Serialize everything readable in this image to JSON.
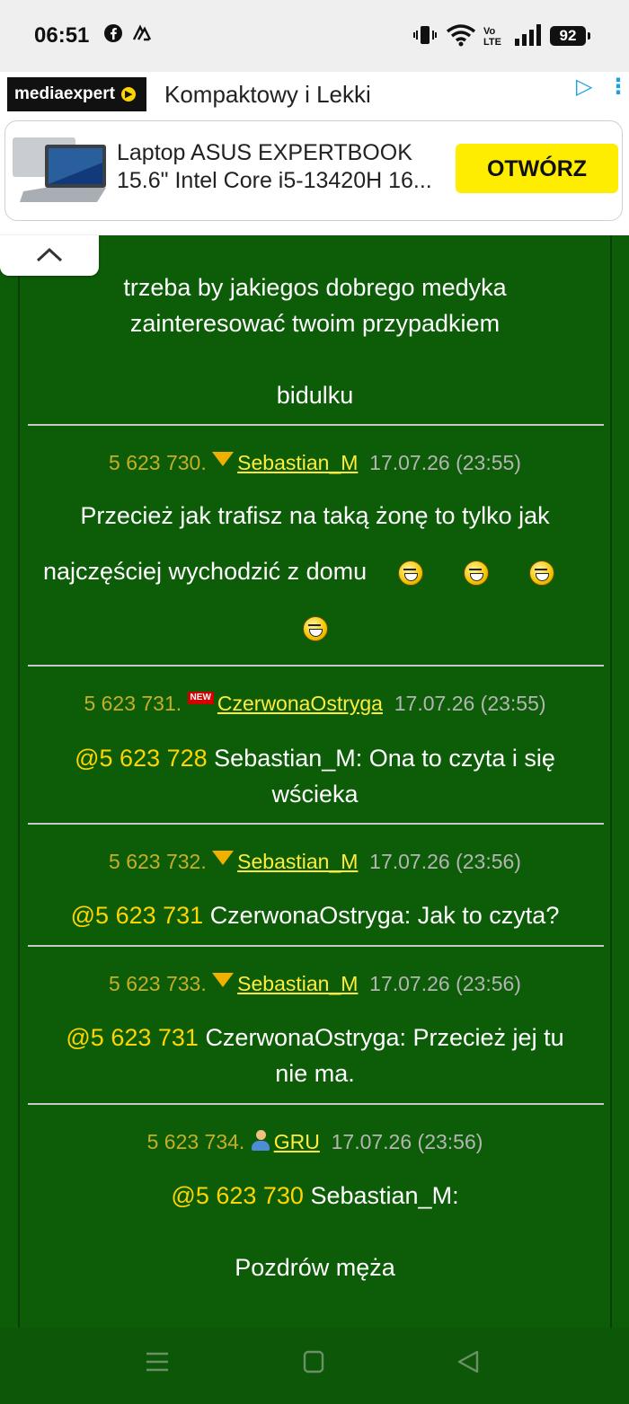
{
  "status_bar": {
    "time": "06:51",
    "battery": "92"
  },
  "ad": {
    "brand": "mediaexpert",
    "headline": "Kompaktowy i Lekki",
    "product_title_line1": "Laptop ASUS EXPERTBOOK",
    "product_title_line2": "15.6\" Intel Core i5-13420H 16...",
    "cta": "OTWÓRZ"
  },
  "top_post": {
    "line1": "trzeba by jakiegos dobrego medyka",
    "line2": "zainteresować twoim przypadkiem",
    "line3": "bidulku"
  },
  "posts": [
    {
      "number": "5 623 730.",
      "user": "Sebastian_M",
      "date": "17.07.26 (23:55)",
      "text": "Przecież jak trafisz na taką żonę to tylko jak",
      "text2": "najczęściej wychodzić z domu"
    },
    {
      "number": "5 623 731.",
      "user": "CzerwonaOstryga",
      "date": "17.07.26 (23:55)",
      "ref": "@5 623 728",
      "text": "Sebastian_M: Ona to czyta i się",
      "text2": "wścieka"
    },
    {
      "number": "5 623 732.",
      "user": "Sebastian_M",
      "date": "17.07.26 (23:56)",
      "ref": "@5 623 731",
      "text": "CzerwonaOstryga: Jak to czyta?"
    },
    {
      "number": "5 623 733.",
      "user": "Sebastian_M",
      "date": "17.07.26 (23:56)",
      "ref": "@5 623 731",
      "text": "CzerwonaOstryga: Przecież jej tu",
      "text2": "nie ma."
    },
    {
      "number": "5 623 734.",
      "user": "GRU",
      "date": "17.07.26 (23:56)",
      "ref": "@5 623 730",
      "text": "Sebastian_M:",
      "text2": "Pozdrów męża"
    }
  ]
}
